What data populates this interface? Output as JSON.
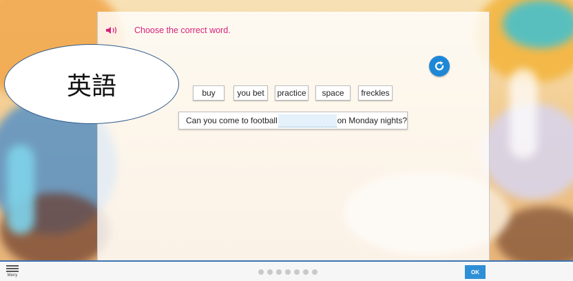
{
  "instruction": {
    "text": "Choose the correct word."
  },
  "overlay_label": "英語",
  "options": [
    "buy",
    "you bet",
    "practice",
    "space",
    "freckles"
  ],
  "sentence": {
    "before": "Can you come to football",
    "after": "on Monday nights?"
  },
  "footer": {
    "menu_label": "Meny",
    "ok_label": "OK",
    "progress_dots": 7
  },
  "colors": {
    "instruction": "#d8207b",
    "accent_blue": "#1e88d6",
    "bar_border": "#3b73b4"
  },
  "icons": {
    "speaker": "speaker-icon",
    "reset": "refresh-icon",
    "menu": "hamburger-icon"
  }
}
